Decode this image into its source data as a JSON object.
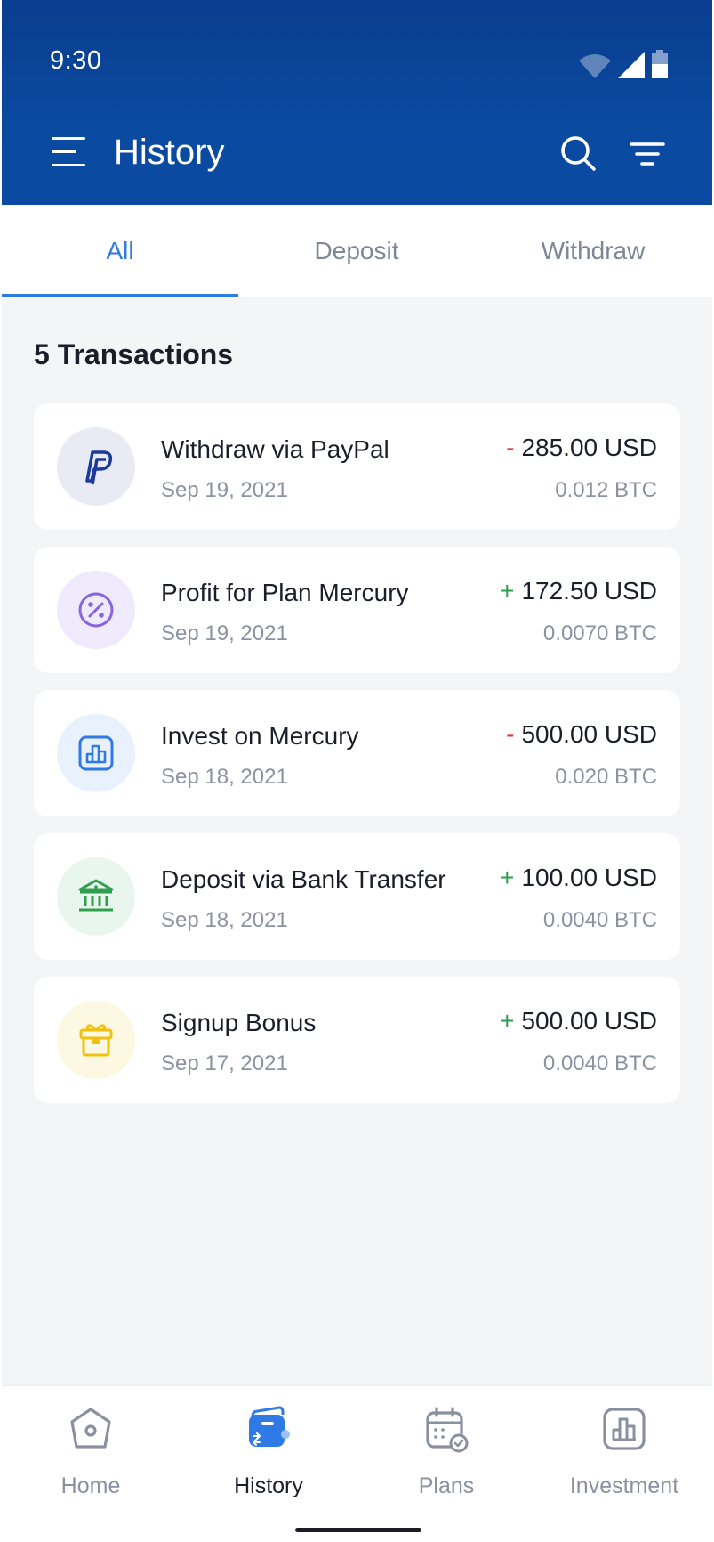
{
  "status_bar": {
    "time": "9:30"
  },
  "header": {
    "title": "History"
  },
  "tabs": [
    {
      "label": "All",
      "active": true
    },
    {
      "label": "Deposit",
      "active": false
    },
    {
      "label": "Withdraw",
      "active": false
    }
  ],
  "summary": {
    "count_label": "5 Transactions"
  },
  "transactions": [
    {
      "title": "Withdraw via PayPal",
      "date": "Sep 19, 2021",
      "sign": "-",
      "amount": "285.00 USD",
      "btc": "0.012 BTC",
      "icon": "paypal-icon",
      "sign_color": "#e53935",
      "icon_bg": "#e8ebf3"
    },
    {
      "title": "Profit for Plan Mercury",
      "date": "Sep 19, 2021",
      "sign": "+",
      "amount": "172.50 USD",
      "btc": "0.0070 BTC",
      "icon": "percent-icon",
      "sign_color": "#2e9e4f",
      "icon_bg": "#efeafc"
    },
    {
      "title": "Invest on Mercury",
      "date": "Sep 18, 2021",
      "sign": "-",
      "amount": "500.00 USD",
      "btc": "0.020 BTC",
      "icon": "chart-icon",
      "sign_color": "#e53935",
      "icon_bg": "#e9f1fd"
    },
    {
      "title": "Deposit via Bank Transfer",
      "date": "Sep 18, 2021",
      "sign": "+",
      "amount": "100.00 USD",
      "btc": "0.0040 BTC",
      "icon": "bank-icon",
      "sign_color": "#2e9e4f",
      "icon_bg": "#e9f6ee"
    },
    {
      "title": "Signup Bonus",
      "date": "Sep 17, 2021",
      "sign": "+",
      "amount": "500.00 USD",
      "btc": "0.0040 BTC",
      "icon": "gift-icon",
      "sign_color": "#2e9e4f",
      "icon_bg": "#fdf8e1"
    }
  ],
  "bottom_nav": [
    {
      "label": "Home",
      "icon": "home-icon",
      "active": false
    },
    {
      "label": "History",
      "icon": "wallet-icon",
      "active": true
    },
    {
      "label": "Plans",
      "icon": "calendar-icon",
      "active": false
    },
    {
      "label": "Investment",
      "icon": "investment-icon",
      "active": false
    }
  ],
  "colors": {
    "header": "#0a4a9f",
    "accent": "#2f7ae5",
    "positive": "#2e9e4f",
    "negative": "#e53935"
  }
}
